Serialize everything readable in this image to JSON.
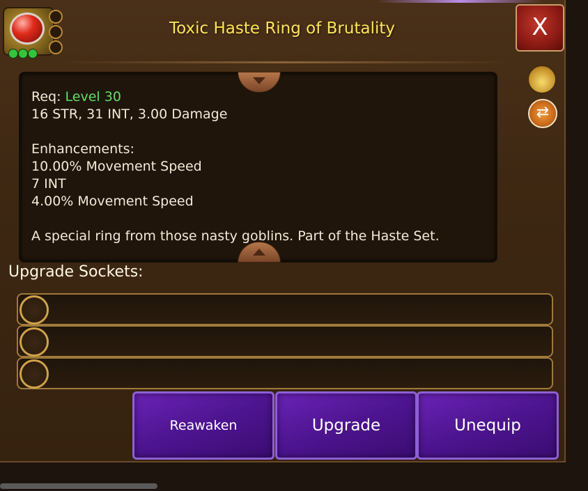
{
  "header": {
    "title": "Toxic Haste Ring of Brutality",
    "close_label": "X"
  },
  "item_description": {
    "req_label": "Req: ",
    "req_value": "Level 30",
    "stats": "16 STR, 31 INT, 3.00 Damage",
    "enhancements_label": "Enhancements:",
    "enhancements": [
      "10.00% Movement Speed",
      "7 INT",
      "4.00% Movement Speed"
    ],
    "flavor": "A special ring from those nasty goblins. Part of the Haste Set."
  },
  "sockets": {
    "label": "Upgrade Sockets:",
    "count": 3
  },
  "actions": {
    "reawaken": "Reawaken",
    "upgrade": "Upgrade",
    "unequip": "Unequip"
  },
  "side_icons": [
    "coin-bag-icon",
    "swap-icon"
  ],
  "colors": {
    "title": "#ffe55a",
    "level": "#5fe05f",
    "button": "#4d148f"
  }
}
